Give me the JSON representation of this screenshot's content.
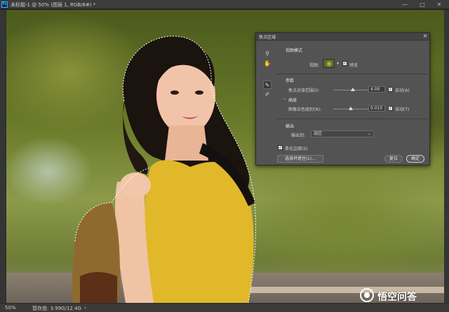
{
  "window": {
    "app_icon_label": "Ps",
    "doc_title": "未标题-1 @ 50% (图层 1, RGB/8#) *",
    "minimize": "—",
    "maximize": "□",
    "close": "✕"
  },
  "dialog": {
    "title": "焦点区域",
    "close": "✕",
    "tools": [
      {
        "icon": "zoom-icon",
        "glyph": "⚲"
      },
      {
        "icon": "hand-icon",
        "glyph": "✋"
      },
      {
        "icon": "focus-add-brush-icon",
        "glyph": "✎"
      },
      {
        "icon": "focus-subtract-brush-icon",
        "glyph": "✐"
      }
    ],
    "view_mode": {
      "section_label": "视图模式",
      "view_label": "视图:",
      "view_dropdown_arrow": "▾",
      "preview_label": "预览",
      "preview_checked": true
    },
    "parameters": {
      "section_label": "参数",
      "focus_range_label": "焦点对准范围(I):",
      "focus_range_value": "4.00",
      "focus_range_fraction": 0.55,
      "focus_auto_label": "自动(A)",
      "focus_auto_checked": true,
      "advanced_label": "高级",
      "advanced_chevron": "⌄",
      "noise_label": "图像杂色级别(N):",
      "noise_value": "0.010",
      "noise_fraction": 0.5,
      "noise_auto_label": "自动(T)",
      "noise_auto_checked": true
    },
    "output": {
      "section_label": "输出",
      "output_to_label": "输出到:",
      "output_to_value": "选区",
      "chevron": "⌄",
      "soften_label": "柔化边缘(S)",
      "soften_checked": true
    },
    "buttons": {
      "select_and_mask": "选择并遮住(L)...",
      "reset": "复位",
      "ok": "确定"
    }
  },
  "statusbar": {
    "zoom": "50%",
    "doc_size": "暂存盘: 3.99G/12.4G",
    "arrow": "›"
  },
  "watermark": {
    "text": "悟空问答"
  },
  "colors": {
    "accent_ps": "#31a8ff",
    "dialog_bg": "#535353",
    "shirt": "#e0b82a"
  }
}
